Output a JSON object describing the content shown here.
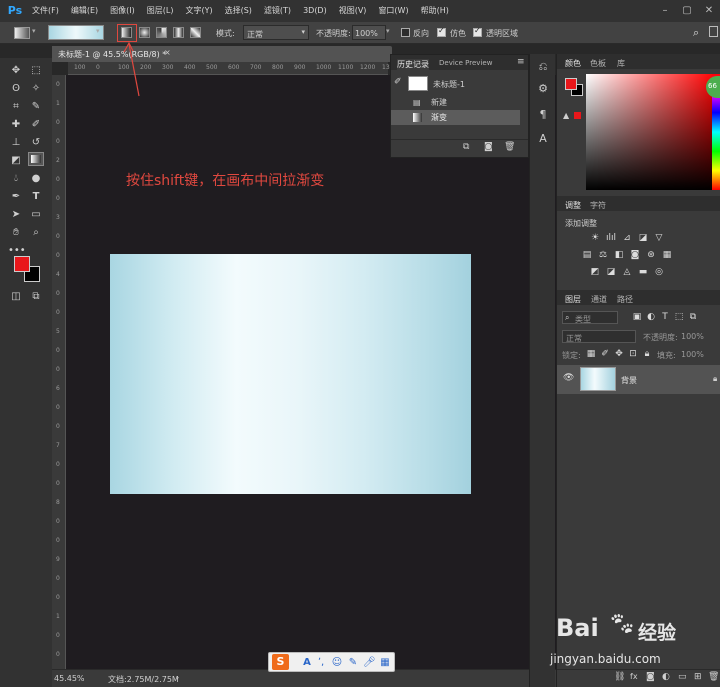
{
  "app": {
    "logo": "Ps"
  },
  "menu": [
    "文件(F)",
    "编辑(E)",
    "图像(I)",
    "图层(L)",
    "文字(Y)",
    "选择(S)",
    "滤镜(T)",
    "3D(D)",
    "视图(V)",
    "窗口(W)",
    "帮助(H)"
  ],
  "window_controls": [
    "–",
    "▢",
    "✕"
  ],
  "options": {
    "mode_label": "模式:",
    "mode_value": "正常",
    "opacity_label": "不透明度:",
    "opacity_value": "100%",
    "reverse_label": "反向",
    "dither_label": "仿色",
    "transparency_label": "透明区域",
    "dither_checked": true,
    "transparency_checked": true,
    "reverse_checked": false
  },
  "document": {
    "tab_title": "未标题-1 @ 45.5%(RGB/8) *",
    "ruler_top": [
      "100",
      "0",
      "100",
      "200",
      "300",
      "400",
      "500",
      "600",
      "700",
      "800",
      "900",
      "1000",
      "1100",
      "1200",
      "1300",
      "1400"
    ],
    "ruler_left": [
      "0",
      "1",
      "0",
      "0",
      "2",
      "0",
      "0",
      "3",
      "0",
      "0",
      "4",
      "0",
      "0",
      "5",
      "0",
      "0",
      "6",
      "0",
      "0",
      "7",
      "0",
      "0",
      "8",
      "0",
      "0",
      "9",
      "0",
      "0",
      "1",
      "0",
      "0"
    ],
    "instruction_text": "按住shift键，在画布中间拉渐变"
  },
  "status": {
    "zoom": "45.45%",
    "doc_size": "文档:2.75M/2.75M"
  },
  "history": {
    "tab_active": "历史记录",
    "tab_inactive": "Device Preview",
    "snapshot_label": "未标题-1",
    "items": [
      "新建",
      "渐变"
    ]
  },
  "panels": {
    "color_tab": "颜色",
    "swatch_tab": "色板",
    "library_tab": "库",
    "adjust_tab": "调整",
    "char_tab": "字符",
    "add_adjust_label": "添加调整",
    "layers_tab": "图层",
    "channels_tab": "通道",
    "paths_tab": "路径",
    "kind_label": "类型",
    "blend_value": "正常",
    "opacity_label": "不透明度:",
    "opacity_value": "100%",
    "lock_label": "锁定:",
    "fill_label": "填充:",
    "fill_value": "100%",
    "layer_name": "背景",
    "green_badge": "66"
  },
  "colors": {
    "foreground": "#e8171b",
    "background": "#000000",
    "instruction": "#e0483f"
  },
  "input_bar": {
    "logo": "S"
  },
  "watermark": {
    "brand": "Bai",
    "brand_suffix": "经验",
    "url": "jingyan.baidu.com"
  }
}
